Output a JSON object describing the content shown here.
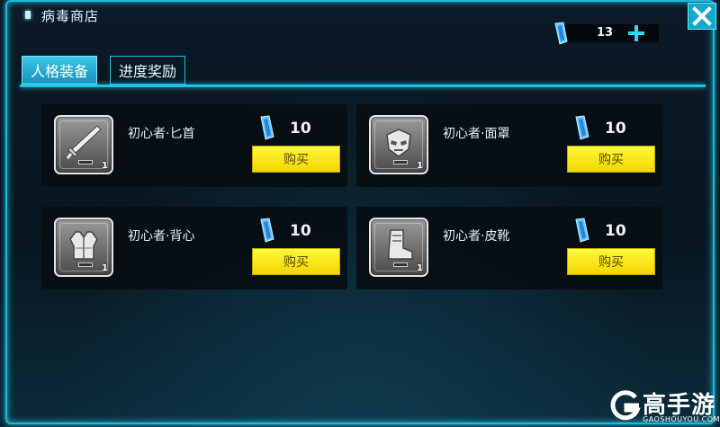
{
  "title": "病毒商店",
  "currency": {
    "amount": "13",
    "icon": "crystal-icon",
    "plus_icon": "plus-icon"
  },
  "tabs": [
    {
      "label": "人格装备",
      "active": true
    },
    {
      "label": "进度奖励",
      "active": false
    }
  ],
  "items": [
    {
      "name": "初心者·匕首",
      "icon": "dagger-icon",
      "count": "1",
      "price": "10",
      "buy_label": "购买"
    },
    {
      "name": "初心者·面罩",
      "icon": "mask-icon",
      "count": "1",
      "price": "10",
      "buy_label": "购买"
    },
    {
      "name": "初心者·背心",
      "icon": "vest-icon",
      "count": "1",
      "price": "10",
      "buy_label": "购买"
    },
    {
      "name": "初心者·皮靴",
      "icon": "boot-icon",
      "count": "1",
      "price": "10",
      "buy_label": "购买"
    }
  ],
  "watermark": {
    "name": "高手游",
    "url": "GAOSHOUYOU.COM"
  },
  "colors": {
    "accent": "#1fc4e8",
    "buy": "#f6e20a",
    "tab_active": "#2ab3d8"
  }
}
